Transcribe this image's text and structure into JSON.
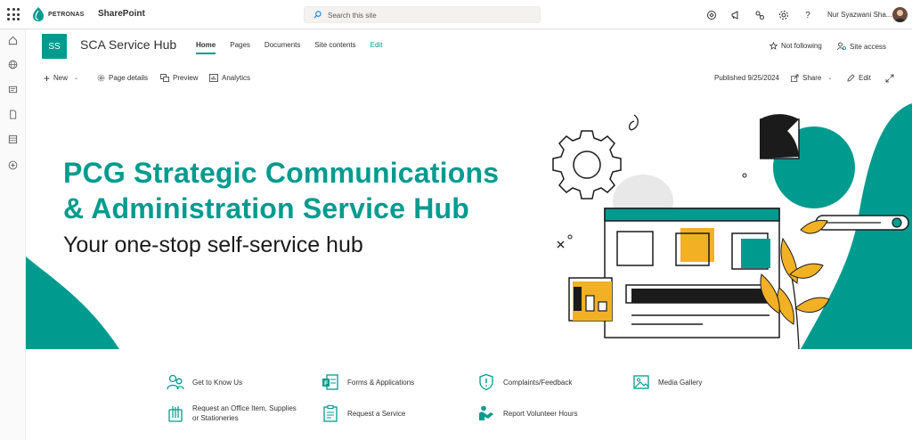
{
  "suite": {
    "brand": "PETRONAS",
    "app_name": "SharePoint",
    "search_placeholder": "Search this site",
    "user_name": "Nur Syazwani Sha...",
    "icons": [
      "copilot-icon",
      "megaphone-icon",
      "share-apps-icon",
      "gear-icon",
      "help-icon"
    ]
  },
  "site": {
    "logo_initials": "SS",
    "title": "SCA Service Hub",
    "nav": [
      {
        "label": "Home",
        "active": true
      },
      {
        "label": "Pages"
      },
      {
        "label": "Documents"
      },
      {
        "label": "Site contents"
      },
      {
        "label": "Edit"
      }
    ],
    "follow_label": "Not following",
    "access_label": "Site access"
  },
  "commands": {
    "new_label": "New",
    "page_details_label": "Page details",
    "preview_label": "Preview",
    "analytics_label": "Analytics",
    "published_label": "Published 9/25/2024",
    "share_label": "Share",
    "edit_label": "Edit"
  },
  "hero": {
    "title_line1": "PCG Strategic Communications",
    "title_line2": "& Administration Service Hub",
    "subtitle": "Your one-stop self-service hub"
  },
  "quick_links": [
    {
      "label": "Get to Know Us",
      "icon": "people-icon"
    },
    {
      "label": "Forms & Applications",
      "icon": "forms-icon"
    },
    {
      "label": "Complaints/Feedback",
      "icon": "shield-alert-icon"
    },
    {
      "label": "Media Gallery",
      "icon": "image-icon"
    },
    {
      "label": "Request an Office Item, Supplies or Stationeries",
      "icon": "stationery-icon"
    },
    {
      "label": "Request a Service",
      "icon": "clipboard-icon"
    },
    {
      "label": "Report Volunteer Hours",
      "icon": "volunteer-icon"
    }
  ],
  "colors": {
    "accent": "#009b8f",
    "yellow": "#f2b125",
    "dark": "#1b1b1b"
  }
}
